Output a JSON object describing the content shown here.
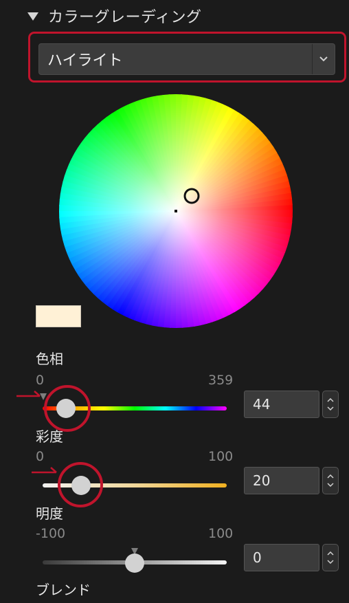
{
  "section": {
    "title": "カラーグレーディング"
  },
  "dropdown": {
    "selected": "ハイライト"
  },
  "hue": {
    "label": "色相",
    "min": "0",
    "max": "359",
    "value": "44",
    "fraction": 0.123
  },
  "saturation": {
    "label": "彩度",
    "min": "0",
    "max": "100",
    "value": "20",
    "fraction": 0.2
  },
  "luminance": {
    "label": "明度",
    "min": "-100",
    "max": "100",
    "value": "0",
    "fraction": 0.5
  },
  "blend": {
    "label": "ブレンド"
  },
  "colors": {
    "accent_red": "#c0142c",
    "swatch": "#fff1d6"
  },
  "icons": {
    "collapse": "triangle-down-icon",
    "dropdown": "chevron-down-icon",
    "spinner": "spinner-arrows-icon"
  }
}
